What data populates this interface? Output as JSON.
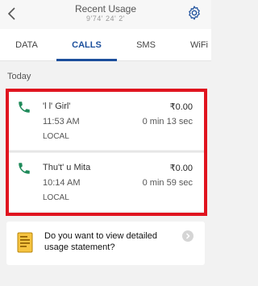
{
  "header": {
    "title": "Recent Usage",
    "subtitle": "9'74' 24' 2'"
  },
  "tabs": [
    {
      "label": "DATA",
      "active": false
    },
    {
      "label": "CALLS",
      "active": true
    },
    {
      "label": "SMS",
      "active": false
    },
    {
      "label": "WiFi",
      "active": false
    }
  ],
  "section_label": "Today",
  "calls": [
    {
      "name": "'l l' Girl'",
      "amount": "₹0.00",
      "time": "11:53 AM",
      "duration": "0 min 13 sec",
      "type": "LOCAL"
    },
    {
      "name": "Thu't' u Mita",
      "amount": "₹0.00",
      "time": "10:14 AM",
      "duration": "0 min 59 sec",
      "type": "LOCAL"
    }
  ],
  "statement": {
    "text": "Do you want to view detailed usage statement?"
  },
  "colors": {
    "accent": "#1c4f9c",
    "highlight": "#e0141f",
    "phone_icon": "#1f8a5a"
  }
}
